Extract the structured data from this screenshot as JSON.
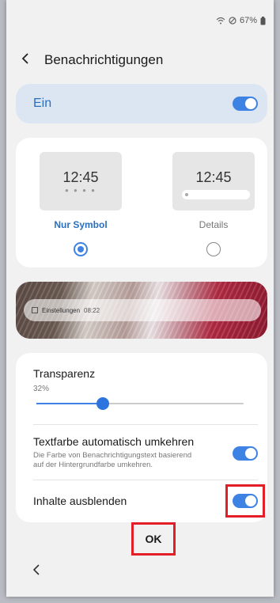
{
  "status_bar": {
    "battery_text": "67%",
    "icons": [
      "wifi-icon",
      "dnd-icon",
      "battery-icon"
    ]
  },
  "header": {
    "title": "Benachrichtigungen",
    "back_icon": "chevron-left-icon"
  },
  "master_toggle": {
    "label": "Ein",
    "on": true
  },
  "notification_styles": [
    {
      "name": "Nur Symbol",
      "preview_time": "12:45",
      "selected": true
    },
    {
      "name": "Details",
      "preview_time": "12:45",
      "selected": false
    }
  ],
  "preview_notification": {
    "app": "Einstellungen",
    "time": "08:22"
  },
  "settings": {
    "transparency": {
      "title": "Transparenz",
      "value_text": "32%",
      "value": 32
    },
    "auto_invert": {
      "title": "Textfarbe automatisch umkehren",
      "subtitle_line1": "Die Farbe von Benachrichtigungstext basierend",
      "subtitle_line2": "auf der Hintergrundfarbe umkehren.",
      "on": true
    },
    "hide_content": {
      "title": "Inhalte ausblenden",
      "on": true
    }
  },
  "ok_button": {
    "label": "OK"
  },
  "colors": {
    "accent": "#3e82e4",
    "highlight": "#e41e26",
    "header_card": "#dce6f3"
  }
}
